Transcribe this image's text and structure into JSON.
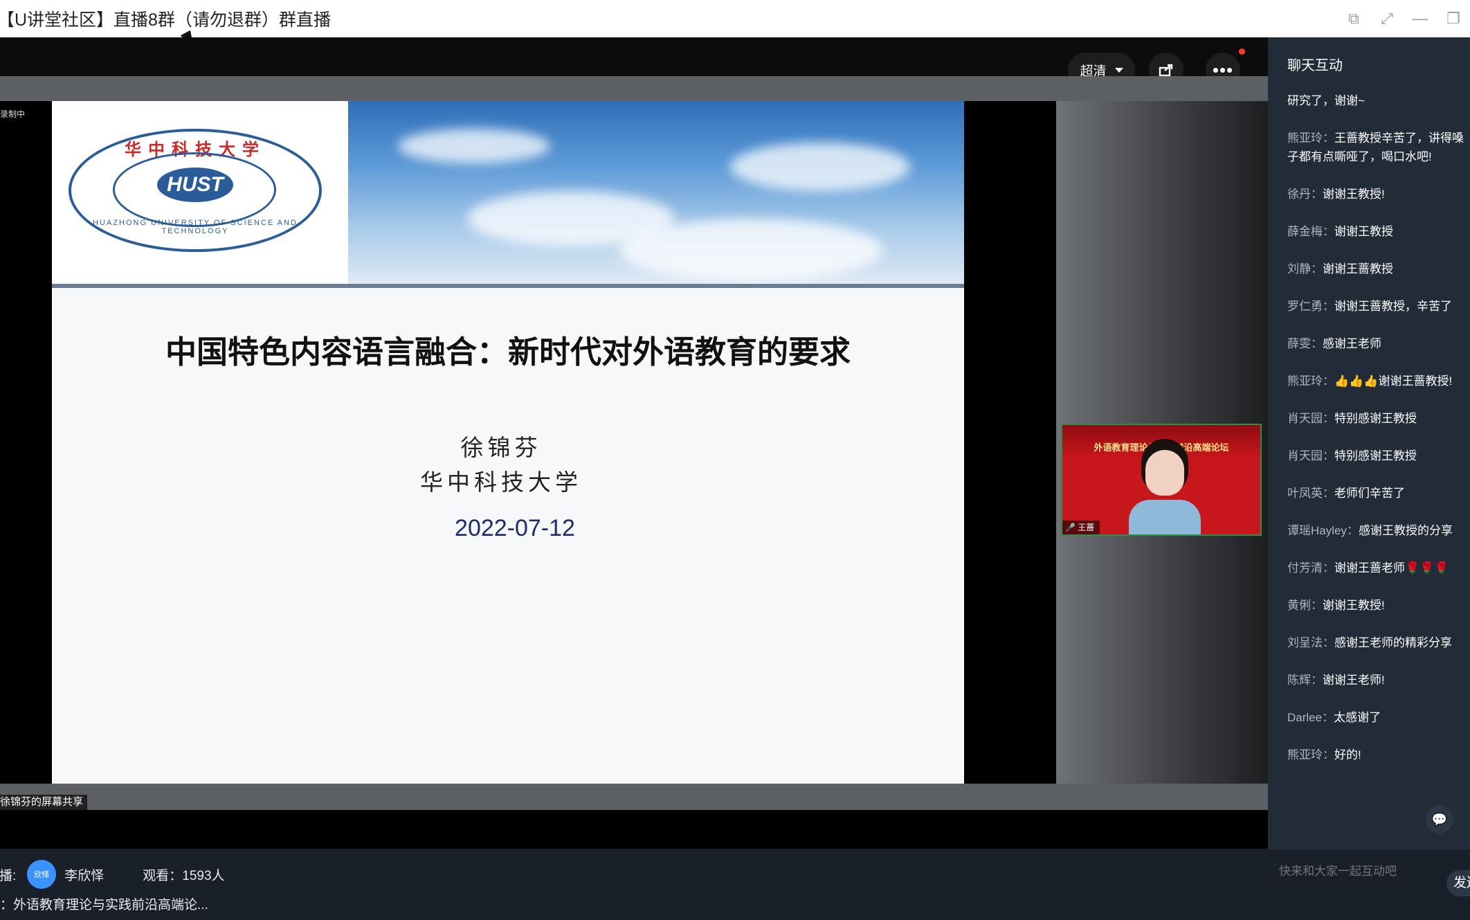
{
  "window": {
    "title": "【U讲堂社区】直播8群（请勿退群）群直播"
  },
  "player": {
    "quality_label": "超清",
    "recording_label": "录制中",
    "share_caption": "徐锦芬的屏幕共享",
    "pip_name": "王蔷"
  },
  "slide": {
    "title": "中国特色内容语言融合：新时代对外语教育的要求",
    "author": "徐锦芬",
    "organization": "华中科技大学",
    "date": "2022-07-12",
    "logo_text_top": "华中科技大学",
    "logo_text_bottom": "HUAZHONG UNIVERSITY OF SCIENCE AND TECHNOLOGY",
    "logo_emblem": "HUST"
  },
  "pip": {
    "banner": "外语教育理论与实践前沿高端论坛"
  },
  "host": {
    "label": "主播:",
    "avatar_text": "欣怿",
    "name": "李欣怿",
    "viewers": "观看：1593人"
  },
  "topic": {
    "text": "主题：外语教育理论与实践前沿高端论..."
  },
  "chat": {
    "title": "聊天互动",
    "input_placeholder": "快来和大家一起互动吧",
    "send_label": "发送",
    "messages": [
      {
        "name": "",
        "text": "研究了，谢谢~"
      },
      {
        "name": "熊亚玲：",
        "text": "王蔷教授辛苦了，讲得嗓子都有点嘶哑了，喝口水吧!"
      },
      {
        "name": "徐丹：",
        "text": "谢谢王教授!"
      },
      {
        "name": "薛金梅：",
        "text": "谢谢王教授"
      },
      {
        "name": "刘静：",
        "text": "谢谢王蔷教授"
      },
      {
        "name": "罗仁勇：",
        "text": "谢谢王蔷教授，辛苦了"
      },
      {
        "name": "薛雯：",
        "text": "感谢王老师"
      },
      {
        "name": "熊亚玲：",
        "text": "👍👍👍谢谢王蔷教授!"
      },
      {
        "name": "肖天园：",
        "text": "特别感谢王教授"
      },
      {
        "name": "肖天园：",
        "text": "特别感谢王教授"
      },
      {
        "name": "叶凤英：",
        "text": "老师们辛苦了"
      },
      {
        "name": "谭瑶Hayley：",
        "text": "感谢王教授的分享"
      },
      {
        "name": "付芳清：",
        "text": "谢谢王蔷老师🌹🌹🌹"
      },
      {
        "name": "黄俐：",
        "text": "谢谢王教授!"
      },
      {
        "name": "刘呈法：",
        "text": "感谢王老师的精彩分享"
      },
      {
        "name": "陈辉：",
        "text": "谢谢王老师!"
      },
      {
        "name": "Darlee：",
        "text": "太感谢了"
      },
      {
        "name": "熊亚玲：",
        "text": "好的!"
      }
    ]
  }
}
